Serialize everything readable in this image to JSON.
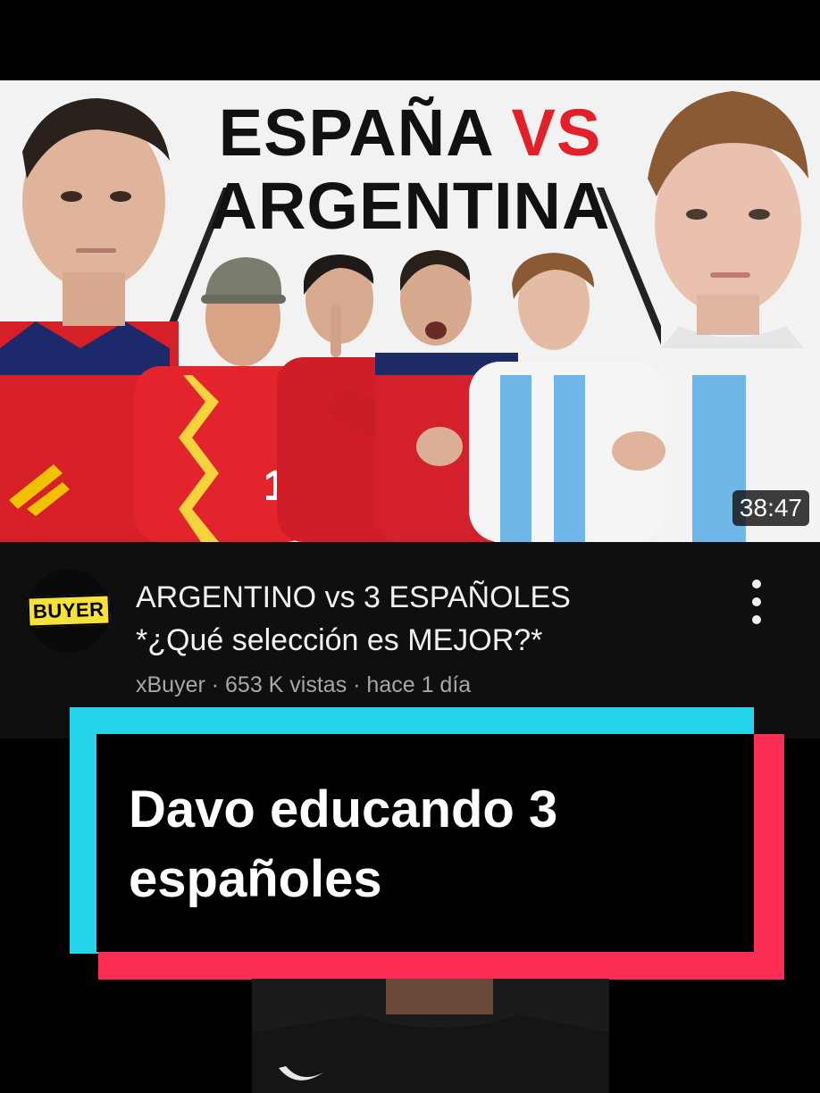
{
  "thumbnail": {
    "title_line1": "ESPAÑA",
    "title_vs": "VS",
    "title_line2": "ARGENTINA",
    "jersey_number": "15",
    "duration": "38:47",
    "colors": {
      "spain_red": "#e3202a",
      "argentina_blue": "#6fb7e8"
    }
  },
  "video": {
    "channel_logo_text": "BUYER",
    "title_line1": "ARGENTINO vs 3 ESPAÑOLES",
    "title_line2": "*¿Qué selección es MEJOR?*",
    "meta": "xBuyer · 653 K vistas · hace 1 día",
    "menu_icon": "more-vertical-icon"
  },
  "caption": {
    "line1": "Davo educando 3",
    "line2": "españoles",
    "colors": {
      "cyan": "#25d3ea",
      "red": "#fb2d55"
    }
  }
}
